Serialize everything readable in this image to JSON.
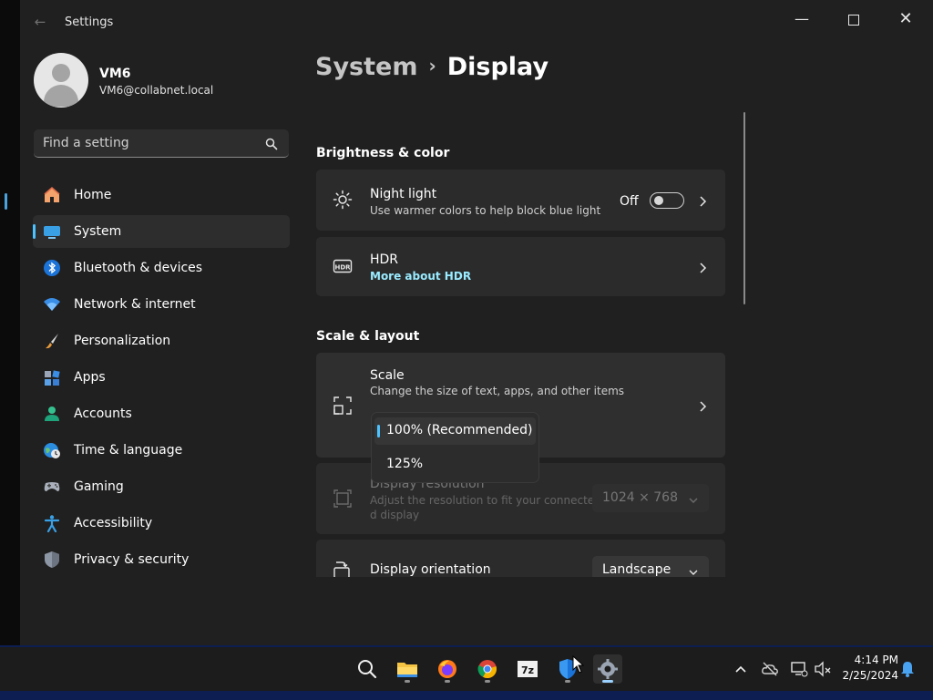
{
  "window": {
    "app_title": "Settings",
    "back": "←",
    "minimize": "—",
    "close": "✕"
  },
  "user": {
    "name": "VM6",
    "email": "VM6@collabnet.local"
  },
  "search": {
    "placeholder": "Find a setting"
  },
  "nav": {
    "items": [
      {
        "label": "Home",
        "icon": "home-icon"
      },
      {
        "label": "System",
        "icon": "system-icon",
        "selected": true
      },
      {
        "label": "Bluetooth & devices",
        "icon": "bluetooth-icon"
      },
      {
        "label": "Network & internet",
        "icon": "wifi-icon"
      },
      {
        "label": "Personalization",
        "icon": "brush-icon"
      },
      {
        "label": "Apps",
        "icon": "apps-icon"
      },
      {
        "label": "Accounts",
        "icon": "accounts-icon"
      },
      {
        "label": "Time & language",
        "icon": "globe-clock-icon"
      },
      {
        "label": "Gaming",
        "icon": "gamepad-icon"
      },
      {
        "label": "Accessibility",
        "icon": "accessibility-icon"
      },
      {
        "label": "Privacy & security",
        "icon": "shield-icon"
      }
    ]
  },
  "breadcrumb": {
    "parent": "System",
    "separator": "›",
    "current": "Display"
  },
  "sections": {
    "brightness": {
      "heading": "Brightness & color",
      "night_light": {
        "title": "Night light",
        "subtitle": "Use warmer colors to help block blue light",
        "state": "Off"
      },
      "hdr": {
        "title": "HDR",
        "link": "More about HDR"
      }
    },
    "scale_layout": {
      "heading": "Scale & layout",
      "scale": {
        "title": "Scale",
        "subtitle": "Change the size of text, apps, and other items"
      },
      "resolution": {
        "title": "Display resolution",
        "subtitle_line1": "Adjust the resolution to fit your connecte",
        "subtitle_line2": "d display",
        "value": "1024 × 768"
      },
      "orientation": {
        "title": "Display orientation",
        "value": "Landscape"
      }
    }
  },
  "scale_dropdown": {
    "options": [
      "100% (Recommended)",
      "125%"
    ],
    "selected": "100% (Recommended)"
  },
  "taskbar": {
    "apps": [
      "search-icon",
      "file-explorer-icon",
      "firefox-icon",
      "chrome-icon",
      "7zip-icon",
      "defender-shield-icon",
      "settings-gear-icon"
    ],
    "time": "4:14 PM",
    "date": "2/25/2024"
  },
  "colors": {
    "accent": "#4cc2ff",
    "link": "#99ebff",
    "card": "#2b2b2b",
    "window": "#202020"
  }
}
